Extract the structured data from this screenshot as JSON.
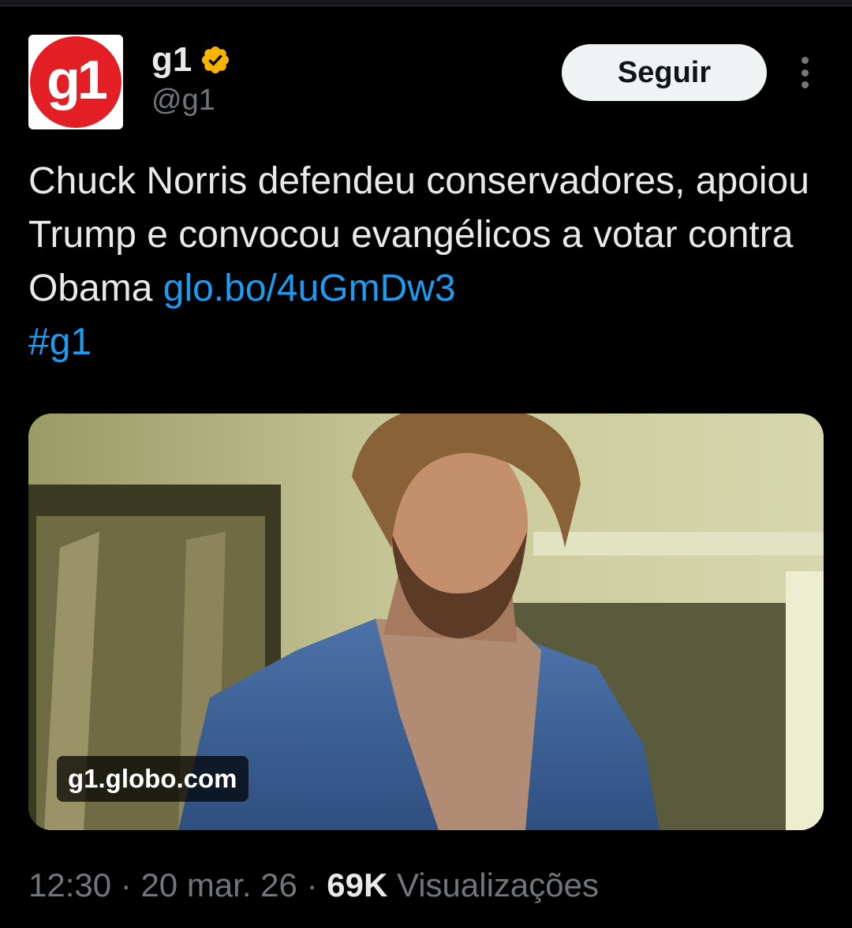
{
  "account": {
    "display_name": "g1",
    "handle": "@g1",
    "avatar_text": "g1",
    "verified": true,
    "verified_color": "#f4b400"
  },
  "actions": {
    "follow_label": "Seguir",
    "more_icon": "more-vertical-icon"
  },
  "tweet": {
    "text": "Chuck Norris defendeu conservadores, apoiou Trump e convocou evangélicos a votar contra Obama ",
    "link": "glo.bo/4uGmDw3",
    "hashtag": "#g1",
    "link_color": "#1d9bf0"
  },
  "media": {
    "domain": "g1.globo.com"
  },
  "meta": {
    "time": "12:30",
    "separator": " · ",
    "date": "20 mar. 26",
    "views_count": "69K",
    "views_label": "Visualizações"
  },
  "colors": {
    "background": "#000000",
    "text": "#e7e9ea",
    "secondary": "#71767b",
    "brand_red": "#e31e24",
    "button_bg": "#eff3f4"
  }
}
